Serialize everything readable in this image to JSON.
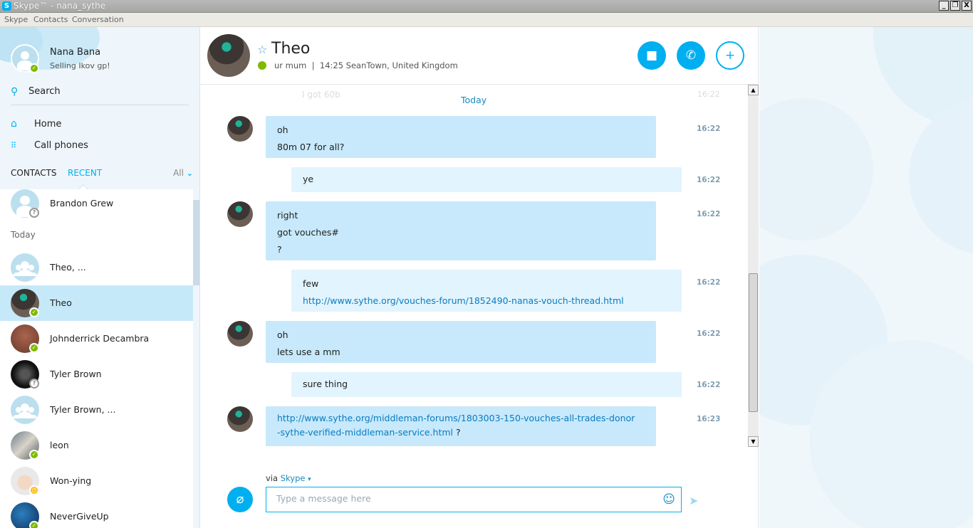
{
  "window": {
    "title": "Skype™ - nana_sythe",
    "app_icon": "S",
    "buttons": [
      "_",
      "❐",
      "X"
    ]
  },
  "menu": [
    "Skype",
    "Contacts",
    "Conversation"
  ],
  "profile": {
    "name": "Nana Bana",
    "mood": "Selling Ikov gp!"
  },
  "search": {
    "label": "Search"
  },
  "nav": [
    {
      "label": "Home",
      "icon": "home-icon"
    },
    {
      "label": "Call phones",
      "icon": "dialpad-icon"
    }
  ],
  "tabs": {
    "contacts": "CONTACTS",
    "recent": "RECENT",
    "filter": "All"
  },
  "contacts": {
    "top": {
      "name": "Brandon Grew",
      "status": "unknown"
    },
    "group_label": "Today",
    "items": [
      {
        "name": "Theo, ...",
        "status": "none"
      },
      {
        "name": "Theo",
        "status": "online"
      },
      {
        "name": "Johnderrick Decambra",
        "status": "online"
      },
      {
        "name": "Tyler Brown",
        "status": "unknown"
      },
      {
        "name": "Tyler Brown, ...",
        "status": "none"
      },
      {
        "name": "leon",
        "status": "online"
      },
      {
        "name": "Won-ying",
        "status": "away"
      },
      {
        "name": "NeverGiveUp",
        "status": "online"
      }
    ]
  },
  "conversation": {
    "name": "Theo",
    "status_text": "ur mum",
    "location": "14:25 SeanTown, United Kingdom",
    "sub_separator": "|",
    "day_label": "Today",
    "ghost_message": "I got 60b",
    "ghost_time": "16:22",
    "messages": [
      {
        "dir": "in",
        "lines": [
          "oh",
          "80m 07 for all?"
        ],
        "time": "16:22"
      },
      {
        "dir": "out",
        "lines": [
          "ye"
        ],
        "time": "16:22"
      },
      {
        "dir": "in",
        "lines": [
          "right",
          "got vouches#",
          "?"
        ],
        "time": "16:22"
      },
      {
        "dir": "out",
        "lines": [
          "few"
        ],
        "link": "http://www.sythe.org/vouches-forum/1852490-nanas-vouch-thread.html",
        "time": "16:22"
      },
      {
        "dir": "in",
        "lines": [
          "oh",
          "lets use a mm"
        ],
        "time": "16:22"
      },
      {
        "dir": "out",
        "lines": [
          "sure thing"
        ],
        "time": "16:22"
      },
      {
        "dir": "in",
        "link_line1": "http://www.sythe.org/middleman-forums/1803003-150-vouches-all-trades-donor",
        "link_line2": "-sythe-verified-middleman-service.html",
        "suffix": " ?",
        "time": "16:23"
      }
    ],
    "via_prefix": "via",
    "via_service": "Skype",
    "input_placeholder": "Type a message here"
  },
  "colors": {
    "accent": "#00aff0",
    "online": "#7fba00",
    "away": "#fdb913",
    "bubble_in": "#c7e9fb",
    "bubble_out": "#e2f4fd"
  }
}
